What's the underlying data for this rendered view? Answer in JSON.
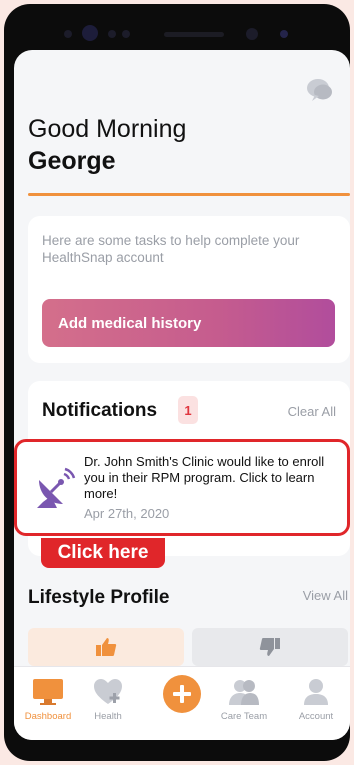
{
  "header": {
    "greeting": "Good Morning",
    "user_name": "George"
  },
  "tasks": {
    "description": "Here are some tasks to help complete your HealthSnap account",
    "button_label": "Add medical history"
  },
  "notifications": {
    "title": "Notifications",
    "count": "1",
    "clear_all": "Clear All",
    "items": [
      {
        "message": "Dr. John Smith's Clinic would like to enroll you in their RPM program. Click to learn more!",
        "date": "Apr 27th, 2020",
        "icon": "satellite-dish-icon"
      }
    ],
    "callout": "Click here"
  },
  "lifestyle": {
    "title": "Lifestyle Profile",
    "view_all": "View All"
  },
  "tabbar": {
    "items": [
      {
        "label": "Dashboard",
        "icon": "monitor-icon",
        "active": true
      },
      {
        "label": "Health",
        "icon": "heart-plus-icon",
        "active": false
      },
      {
        "label": "",
        "icon": "plus-icon",
        "active": false
      },
      {
        "label": "Care Team",
        "icon": "team-icon",
        "active": false
      },
      {
        "label": "Account",
        "icon": "user-icon",
        "active": false
      }
    ]
  },
  "colors": {
    "accent": "#f0913d",
    "highlight": "#e0262a",
    "gradient_start": "#d46f8b",
    "gradient_end": "#b14d9c",
    "icon_purple": "#7a57b0"
  }
}
